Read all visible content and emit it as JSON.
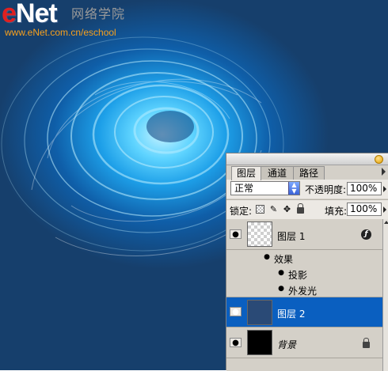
{
  "watermark": {
    "logo_e": "e",
    "logo_rest": "Net",
    "chinese": "网络学院",
    "url": "www.eNet.com.cn/eschool"
  },
  "layers_panel": {
    "tabs": [
      {
        "label": "图层",
        "active": true
      },
      {
        "label": "通道",
        "active": false
      },
      {
        "label": "路径",
        "active": false
      }
    ],
    "blend_mode": "正常",
    "opacity_label": "不透明度:",
    "opacity_value": "100%",
    "lock_label": "锁定:",
    "fill_label": "填充:",
    "fill_value": "100%",
    "layers": [
      {
        "name": "图层 1",
        "visible": true,
        "thumbnail": "transparent",
        "has_effects": true,
        "selected": false,
        "effects_label": "效果",
        "effects": [
          "投影",
          "外发光"
        ]
      },
      {
        "name": "图层 2",
        "visible": true,
        "thumbnail": "navy",
        "selected": true
      },
      {
        "name": "背景",
        "visible": true,
        "thumbnail": "black",
        "locked": true,
        "selected": false
      }
    ],
    "colors": {
      "selection": "#0a5fc0",
      "panel": "#d4d0c8"
    },
    "icons": [
      "eye-icon",
      "fx-icon",
      "lock-icon",
      "move-icon",
      "brush-icon",
      "checker-icon"
    ]
  }
}
